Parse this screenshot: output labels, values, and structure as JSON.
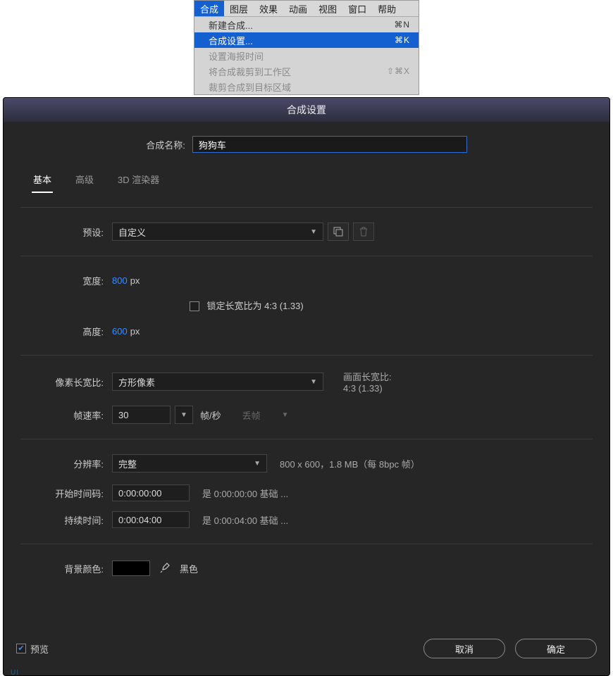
{
  "menubar": {
    "items": [
      "合成",
      "图层",
      "效果",
      "动画",
      "视图",
      "窗口",
      "帮助"
    ],
    "active_index": 0,
    "dropdown": [
      {
        "label": "新建合成...",
        "shortcut": "⌘N",
        "disabled": false,
        "highlight": false
      },
      {
        "label": "合成设置...",
        "shortcut": "⌘K",
        "disabled": false,
        "highlight": true
      },
      {
        "label": "设置海报时间",
        "shortcut": "",
        "disabled": true,
        "highlight": false
      },
      {
        "label": "将合成裁剪到工作区",
        "shortcut": "⇧⌘X",
        "disabled": true,
        "highlight": false
      },
      {
        "label": "裁剪合成到目标区域",
        "shortcut": "",
        "disabled": true,
        "highlight": false
      }
    ]
  },
  "dialog": {
    "title": "合成设置",
    "name_label": "合成名称:",
    "name_value": "狗狗车",
    "tabs": [
      "基本",
      "高级",
      "3D 渲染器"
    ],
    "active_tab": 0,
    "preset": {
      "label": "预设:",
      "value": "自定义",
      "save_icon": "save-preset-icon",
      "trash_icon": "trash-icon"
    },
    "width": {
      "label": "宽度:",
      "value": "800",
      "unit": "px"
    },
    "height": {
      "label": "高度:",
      "value": "600",
      "unit": "px"
    },
    "lock_aspect": {
      "checked": false,
      "label": "锁定长宽比为 4:3 (1.33)"
    },
    "pixel_aspect": {
      "label": "像素长宽比:",
      "value": "方形像素"
    },
    "frame_aspect": {
      "label": "画面长宽比:",
      "value": "4:3 (1.33)"
    },
    "framerate": {
      "label": "帧速率:",
      "value": "30",
      "unit": "帧/秒",
      "drop": "丢帧"
    },
    "resolution": {
      "label": "分辨率:",
      "value": "完整",
      "info": "800 x 600，1.8 MB（每 8bpc 帧）"
    },
    "start_tc": {
      "label": "开始时间码:",
      "value": "0:00:00:00",
      "info": "是 0:00:00:00 基础 ..."
    },
    "duration": {
      "label": "持续时间:",
      "value": "0:00:04:00",
      "info": "是 0:00:04:00 基础 ..."
    },
    "bgcolor": {
      "label": "背景颜色:",
      "swatch": "#000000",
      "name": "黑色"
    },
    "preview": {
      "checked": true,
      "label": "预览"
    },
    "buttons": {
      "cancel": "取消",
      "ok": "确定"
    }
  }
}
